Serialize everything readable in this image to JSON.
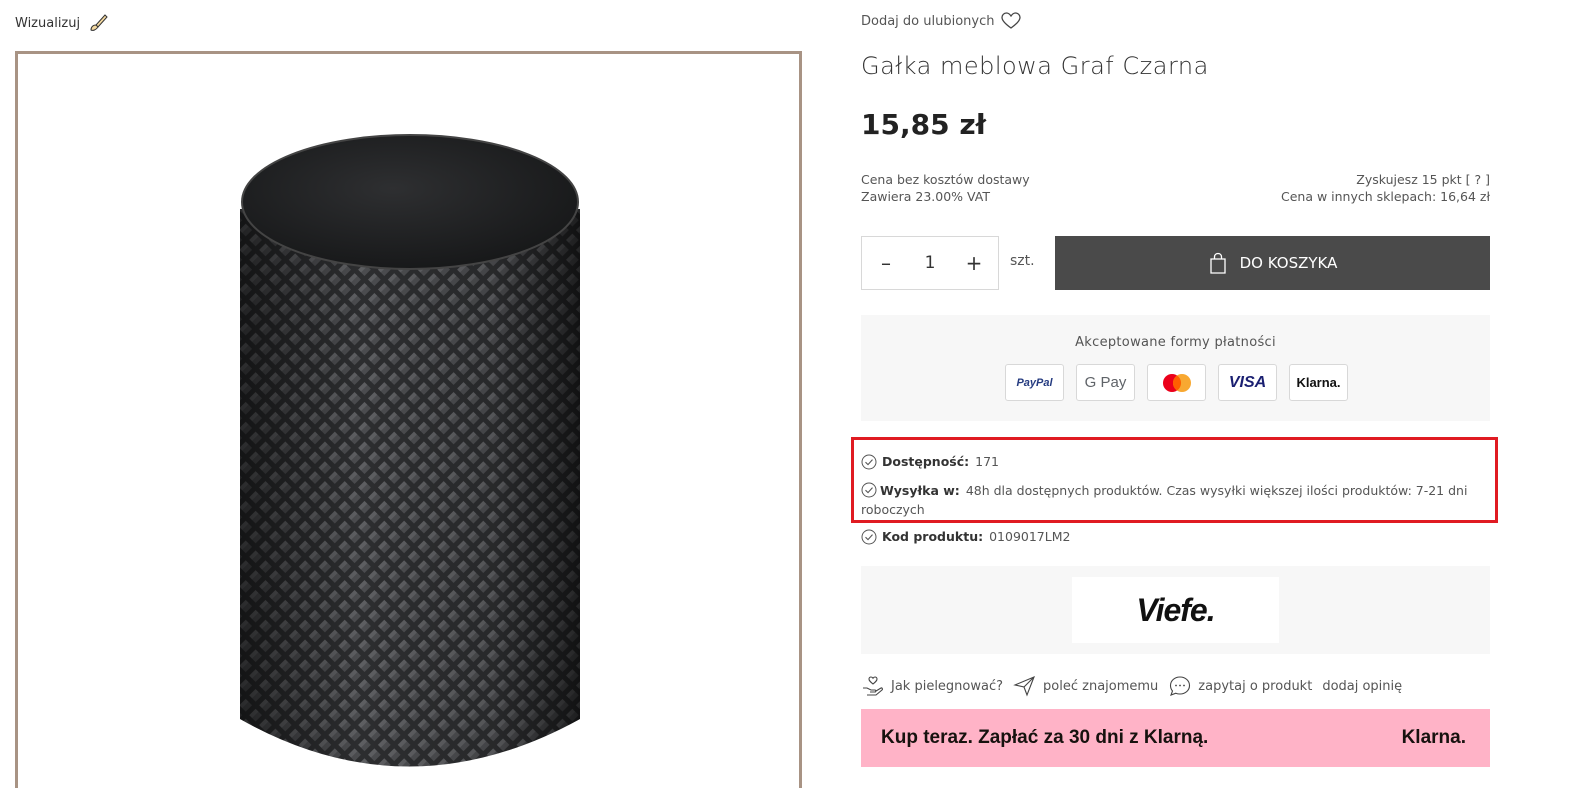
{
  "visualize": {
    "label": "Wizualizuj",
    "icon": "paintbrush-icon"
  },
  "favorite": {
    "label": "Dodaj do ulubionych",
    "icon": "heart-icon"
  },
  "product": {
    "title": "Gałka meblowa Graf Czarna",
    "price": "15,85 zł",
    "shipping_note": "Cena bez kosztów dostawy",
    "vat_note": "Zawiera 23.00% VAT",
    "points": "Zyskujesz 15 pkt [ ? ]",
    "other_shops": "Cena w innych sklepach: 16,64 zł"
  },
  "cart": {
    "minus": "–",
    "quantity": "1",
    "plus": "+",
    "unit": "szt.",
    "add_label": "DO KOSZYKA",
    "icon": "shopping-bag-icon"
  },
  "payments": {
    "label": "Akceptowane formy płatności",
    "methods": [
      "PayPal",
      "G Pay",
      "Mastercard",
      "VISA",
      "Klarna."
    ]
  },
  "details": {
    "availability_label": "Dostępność:",
    "availability_value": "171",
    "shipping_label": "Wysyłka w:",
    "shipping_value": "48h dla dostępnych produktów. Czas wysyłki większej ilości produktów: 7-21 dni roboczych",
    "code_label": "Kod produktu:",
    "code_value": "0109017LM2"
  },
  "brand": {
    "name": "Viefe."
  },
  "links": {
    "care": "Jak pielegnować?",
    "recommend": "poleć znajomemu",
    "ask": "zapytaj o produkt",
    "review": "dodaj opinię"
  },
  "klarna_banner": {
    "text": "Kup teraz. Zapłać za 30 dni z Klarną.",
    "logo": "Klarna."
  },
  "colors": {
    "accent_dark": "#4a4a4a",
    "frame": "#a89384",
    "highlight": "#e01b22",
    "klarna_pink": "#ffb3c7"
  }
}
